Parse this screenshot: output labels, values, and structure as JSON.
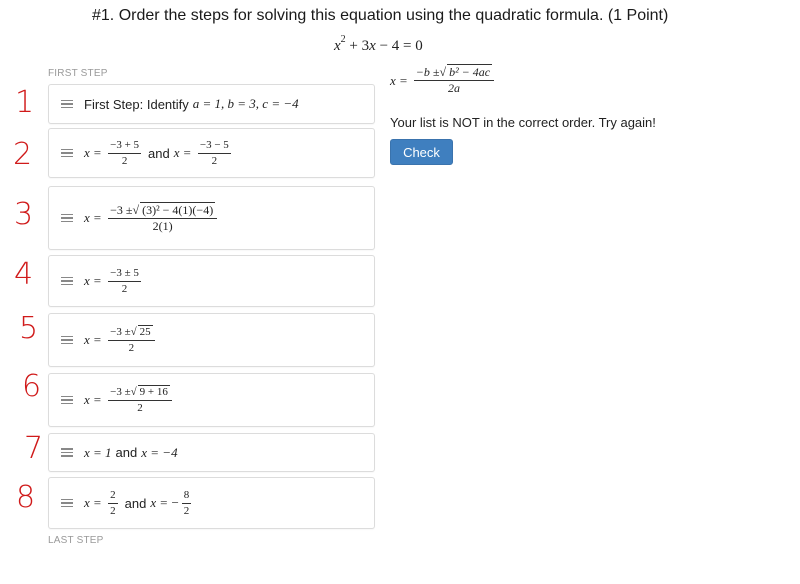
{
  "question": {
    "title": "#1. Order the steps for solving this equation using the quadratic formula. (1 Point)",
    "equation_display": "x² + 3x − 4 = 0"
  },
  "labels": {
    "first_step": "FIRST STEP",
    "last_step": "LAST STEP"
  },
  "steps": [
    {
      "id": "identify",
      "text": "First Step: Identify",
      "math": "a = 1, b = 3, c = −4"
    },
    {
      "id": "split",
      "num1": "−3 + 5",
      "den1": "2",
      "connector": "and",
      "num2": "−3 − 5",
      "den2": "2"
    },
    {
      "id": "substitute",
      "num_pre": "−3 ±",
      "num_rad": "(3)² − 4(1)(−4)",
      "den": "2(1)"
    },
    {
      "id": "simplified",
      "num": "−3 ± 5",
      "den": "2"
    },
    {
      "id": "sqrt25",
      "num_pre": "−3 ±",
      "num_rad": "25",
      "den": "2"
    },
    {
      "id": "sqrt9plus16",
      "num_pre": "−3 ±",
      "num_rad": "9 + 16",
      "den": "2"
    },
    {
      "id": "solutions",
      "lhs1": "x = 1",
      "connector": "and",
      "lhs2": "x = −4"
    },
    {
      "id": "fractions",
      "num1": "2",
      "den1": "2",
      "connector": "and",
      "neg": "−",
      "num2": "8",
      "den2": "2"
    }
  ],
  "formula": {
    "lhs": "x =",
    "num_pre": "−b ±",
    "num_rad": "b² − 4ac",
    "den": "2a"
  },
  "feedback": "Your list is NOT in the correct order. Try again!",
  "check_button": "Check",
  "handwritten_numbers": [
    "1",
    "2",
    "3",
    "4",
    "5",
    "6",
    "7",
    "8"
  ],
  "colors": {
    "button": "#3f7fbf",
    "annotation": "#d01a1a",
    "item_border": "#dcdcdc"
  }
}
